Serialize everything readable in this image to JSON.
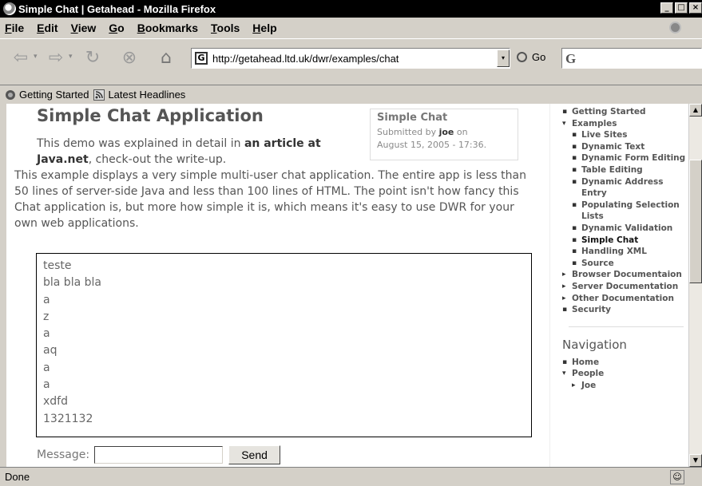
{
  "window": {
    "title": "Simple Chat | Getahead - Mozilla Firefox",
    "min_glyph": "_",
    "max_glyph": "□",
    "close_glyph": "×"
  },
  "menubar": {
    "items": [
      {
        "label": "File"
      },
      {
        "label": "Edit"
      },
      {
        "label": "View"
      },
      {
        "label": "Go"
      },
      {
        "label": "Bookmarks"
      },
      {
        "label": "Tools"
      },
      {
        "label": "Help"
      }
    ]
  },
  "toolbar": {
    "back_glyph": "⇦",
    "forward_glyph": "⇨",
    "reload_glyph": "↻",
    "stop_glyph": "⊗",
    "home_glyph": "⌂",
    "dropdown_glyph": "▾",
    "favicon_glyph": "G",
    "url": "http://getahead.ltd.uk/dwr/examples/chat",
    "go_label": "Go",
    "search_glyph": "G"
  },
  "bookmarks": [
    {
      "label": "Getting Started",
      "icon": "firefox-icon"
    },
    {
      "label": "Latest Headlines",
      "icon": "rss-icon"
    }
  ],
  "page": {
    "title": "Simple Chat Application",
    "byline": {
      "title": "Simple Chat",
      "submitted_prefix": "Submitted by ",
      "author": "joe",
      "submitted_suffix": " on",
      "date": "August 15, 2005 - 17:36."
    },
    "intro_part1": "This demo was explained in detail in ",
    "intro_link": "an article at Java.net",
    "intro_part2": ", check-out the write-up.",
    "description": "This example displays a very simple multi-user chat application. The entire app is less than 50 lines of server-side Java and less than 100 lines of HTML. The point isn't how fancy this Chat application is, but more how simple it is, which means it's easy to use DWR for your own web applications.",
    "messages": [
      "teste",
      "bla bla bla",
      "a",
      "z",
      "a",
      "aq",
      "a",
      "a",
      "xdfd",
      "1321132"
    ],
    "message_label": "Message:",
    "message_value": "",
    "send_label": "Send"
  },
  "sidebar": {
    "tree": [
      {
        "label": "Getting Started",
        "bullet": "▪",
        "level": 0
      },
      {
        "label": "Examples",
        "bullet": "▾",
        "level": 0
      },
      {
        "label": "Live Sites",
        "bullet": "▪",
        "level": 1
      },
      {
        "label": "Dynamic Text",
        "bullet": "▪",
        "level": 1
      },
      {
        "label": "Dynamic Form Editing",
        "bullet": "▪",
        "level": 1
      },
      {
        "label": "Table Editing",
        "bullet": "▪",
        "level": 1
      },
      {
        "label": "Dynamic Address Entry",
        "bullet": "▪",
        "level": 1
      },
      {
        "label": "Populating Selection Lists",
        "bullet": "▪",
        "level": 1
      },
      {
        "label": "Dynamic Validation",
        "bullet": "▪",
        "level": 1
      },
      {
        "label": "Simple Chat",
        "bullet": "▪",
        "level": 1,
        "selected": true
      },
      {
        "label": "Handling XML",
        "bullet": "▪",
        "level": 1
      },
      {
        "label": "Source",
        "bullet": "▪",
        "level": 1
      },
      {
        "label": "Browser Documentaion",
        "bullet": "▸",
        "level": 0
      },
      {
        "label": "Server Documentation",
        "bullet": "▸",
        "level": 0
      },
      {
        "label": "Other Documentation",
        "bullet": "▸",
        "level": 0
      },
      {
        "label": "Security",
        "bullet": "▪",
        "level": 0
      }
    ],
    "nav_heading": "Navigation",
    "nav": [
      {
        "label": "Home",
        "bullet": "▪",
        "level": 0
      },
      {
        "label": "People",
        "bullet": "▾",
        "level": 0
      },
      {
        "label": "Joe",
        "bullet": "▸",
        "level": 1
      }
    ]
  },
  "scrollbar": {
    "up_glyph": "▲",
    "down_glyph": "▼"
  },
  "status": {
    "text": "Done",
    "icon_glyph": "☺"
  }
}
